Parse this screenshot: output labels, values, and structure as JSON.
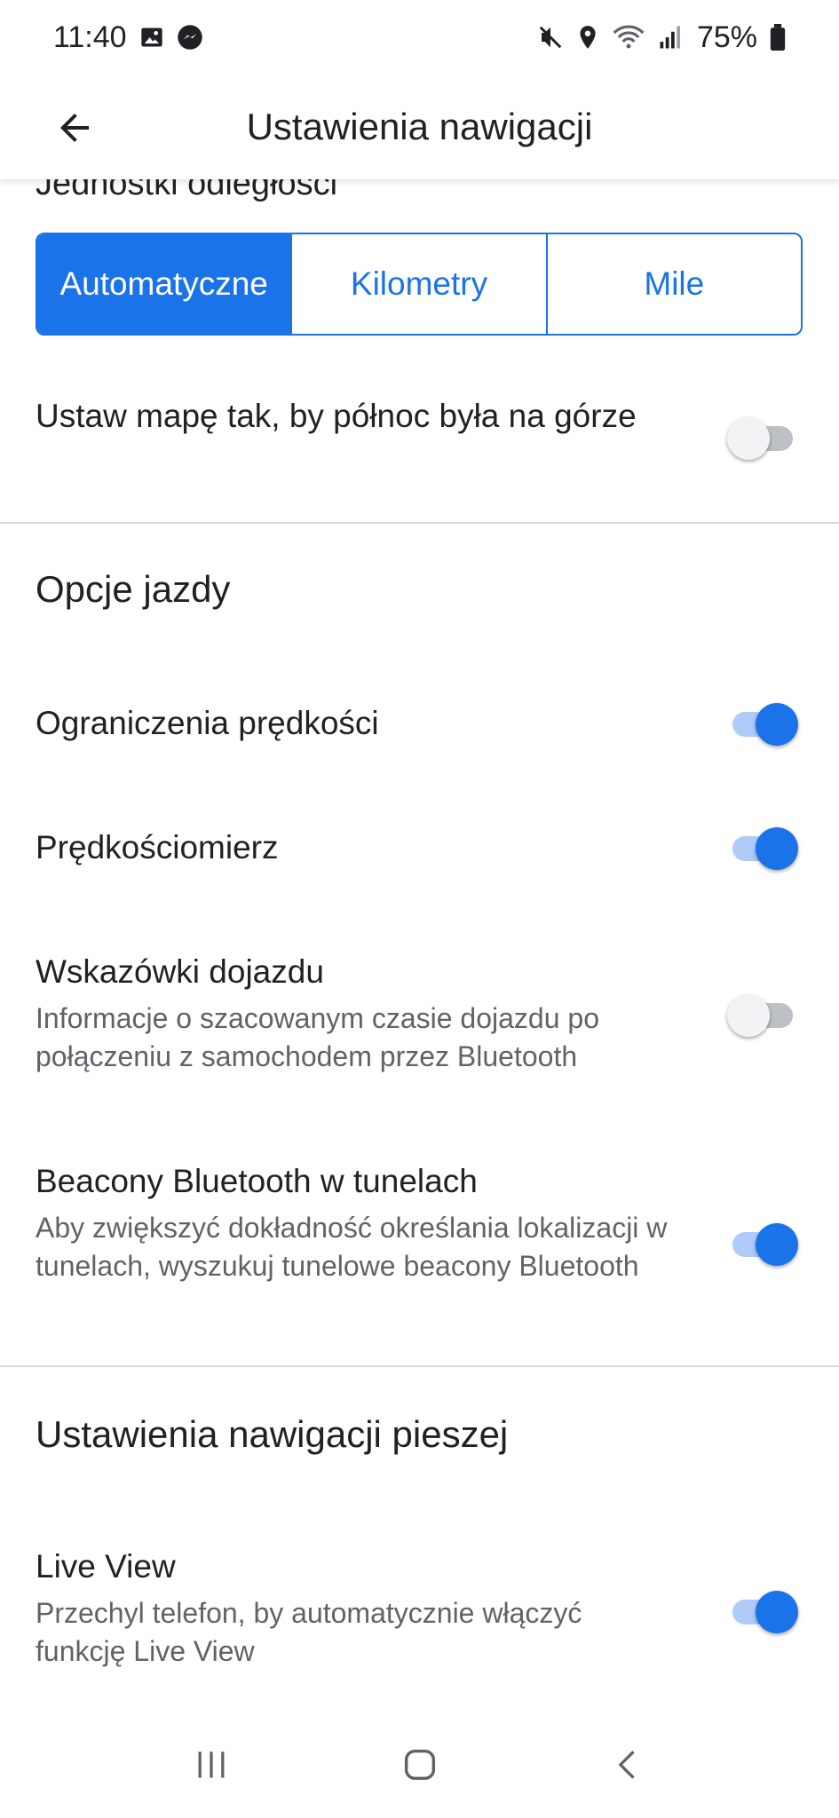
{
  "status_bar": {
    "time": "11:40",
    "battery": "75%",
    "left_icons": [
      "image-icon",
      "messenger-icon"
    ],
    "right_icons": [
      "mute-icon",
      "location-icon",
      "wifi-icon",
      "signal-icon",
      "battery-icon"
    ]
  },
  "app_bar": {
    "title": "Ustawienia nawigacji"
  },
  "distance_units": {
    "label": "Jednostki odległości",
    "options": [
      "Automatyczne",
      "Kilometry",
      "Mile"
    ],
    "selected": "Automatyczne"
  },
  "north_up": {
    "label": "Ustaw mapę tak, by północ była na górze",
    "enabled": false
  },
  "driving": {
    "section_title": "Opcje jazdy",
    "items": [
      {
        "label": "Ograniczenia prędkości",
        "description": "",
        "enabled": true
      },
      {
        "label": "Prędkościomierz",
        "description": "",
        "enabled": true
      },
      {
        "label": "Wskazówki dojazdu",
        "description": "Informacje o szacowanym czasie dojazdu po połączeniu z samochodem przez Bluetooth",
        "enabled": false
      },
      {
        "label": "Beacony Bluetooth w tunelach",
        "description": "Aby zwiększyć dokładność określania lokalizacji w tunelach, wyszukuj tunelowe beacony Bluetooth",
        "enabled": true
      }
    ]
  },
  "walking": {
    "section_title": "Ustawienia nawigacji pieszej",
    "items": [
      {
        "label": "Live View",
        "description": "Przechyl telefon, by automatycznie włączyć funkcję Live View",
        "enabled": true
      }
    ]
  },
  "colors": {
    "accent": "#1a73e8",
    "text": "#202124",
    "secondary_text": "#5f6368",
    "divider": "#dadce0"
  }
}
